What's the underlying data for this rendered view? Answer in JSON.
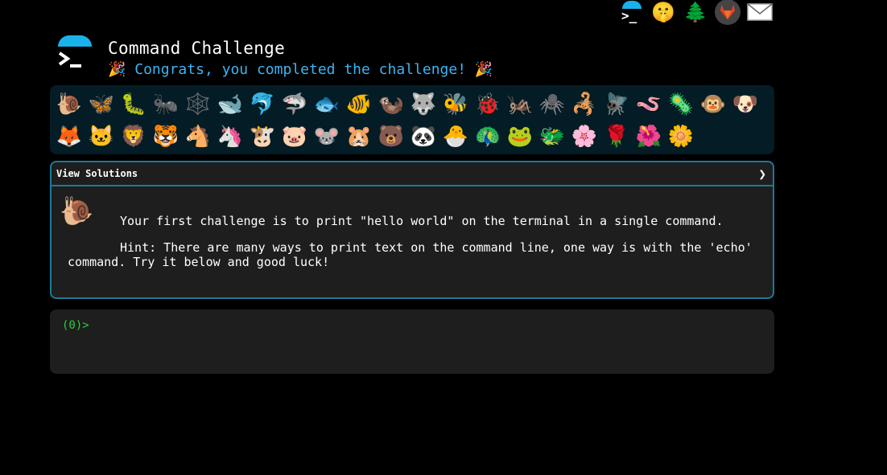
{
  "top_icons": [
    {
      "name": "terminal-logo-icon",
      "glyph": ""
    },
    {
      "name": "shush-face-icon",
      "glyph": "🤫"
    },
    {
      "name": "tree-icon",
      "glyph": "🌲"
    },
    {
      "name": "gitlab-icon",
      "glyph": "🦊"
    },
    {
      "name": "mail-icon",
      "glyph": "✉️"
    }
  ],
  "header": {
    "title": "Command Challenge",
    "congrats": "🎉 Congrats, you completed the challenge! 🎉"
  },
  "badges": [
    {
      "name": "snail",
      "glyph": "🐌"
    },
    {
      "name": "butterfly",
      "glyph": "🦋"
    },
    {
      "name": "caterpillar",
      "glyph": "🐛"
    },
    {
      "name": "ant",
      "glyph": "🐜"
    },
    {
      "name": "spider-web",
      "glyph": "🕸️"
    },
    {
      "name": "whale",
      "glyph": "🐋"
    },
    {
      "name": "dolphin",
      "glyph": "🐬"
    },
    {
      "name": "shark",
      "glyph": "🦈"
    },
    {
      "name": "fish",
      "glyph": "🐟"
    },
    {
      "name": "tropical-fish",
      "glyph": "🐠"
    },
    {
      "name": "otter",
      "glyph": "🦦"
    },
    {
      "name": "wolf",
      "glyph": "🐺"
    },
    {
      "name": "bee",
      "glyph": "🐝"
    },
    {
      "name": "ladybug",
      "glyph": "🐞"
    },
    {
      "name": "cricket",
      "glyph": "🦗"
    },
    {
      "name": "spider",
      "glyph": "🕷️"
    },
    {
      "name": "scorpion",
      "glyph": "🦂"
    },
    {
      "name": "fly",
      "glyph": "🪰"
    },
    {
      "name": "worm",
      "glyph": "🪱"
    },
    {
      "name": "microbe",
      "glyph": "🦠"
    },
    {
      "name": "monkey",
      "glyph": "🐵"
    },
    {
      "name": "dog",
      "glyph": "🐶"
    },
    {
      "name": "fox",
      "glyph": "🦊"
    },
    {
      "name": "cat",
      "glyph": "🐱"
    },
    {
      "name": "lion",
      "glyph": "🦁"
    },
    {
      "name": "tiger",
      "glyph": "🐯"
    },
    {
      "name": "horse",
      "glyph": "🐴"
    },
    {
      "name": "unicorn",
      "glyph": "🦄"
    },
    {
      "name": "cow",
      "glyph": "🐮"
    },
    {
      "name": "pig",
      "glyph": "🐷"
    },
    {
      "name": "mouse",
      "glyph": "🐭"
    },
    {
      "name": "hamster",
      "glyph": "🐹"
    },
    {
      "name": "bear",
      "glyph": "🐻"
    },
    {
      "name": "panda",
      "glyph": "🐼"
    },
    {
      "name": "chick",
      "glyph": "🐣"
    },
    {
      "name": "peacock",
      "glyph": "🦚"
    },
    {
      "name": "frog",
      "glyph": "🐸"
    },
    {
      "name": "dragon",
      "glyph": "🐲"
    },
    {
      "name": "cherry-blossom",
      "glyph": "🌸"
    },
    {
      "name": "rose",
      "glyph": "🌹"
    },
    {
      "name": "hibiscus",
      "glyph": "🌺"
    },
    {
      "name": "sunflower",
      "glyph": "🌼"
    }
  ],
  "panel": {
    "header_label": "View Solutions",
    "chevron": "❯",
    "icon": "🐌",
    "paragraph1": "Your first challenge is to print \"hello world\" on the terminal in a single command.",
    "paragraph2": "Hint: There are many ways to print text on the command line, one way is with the 'echo' command. Try it below and good luck!"
  },
  "terminal": {
    "prompt": "(0)>"
  },
  "colors": {
    "accent": "#1ab2ea",
    "congrats": "#3db4f2",
    "prompt": "#2ecc40",
    "panel_border": "#1a7a9a",
    "badge_bg": "#041c25"
  }
}
